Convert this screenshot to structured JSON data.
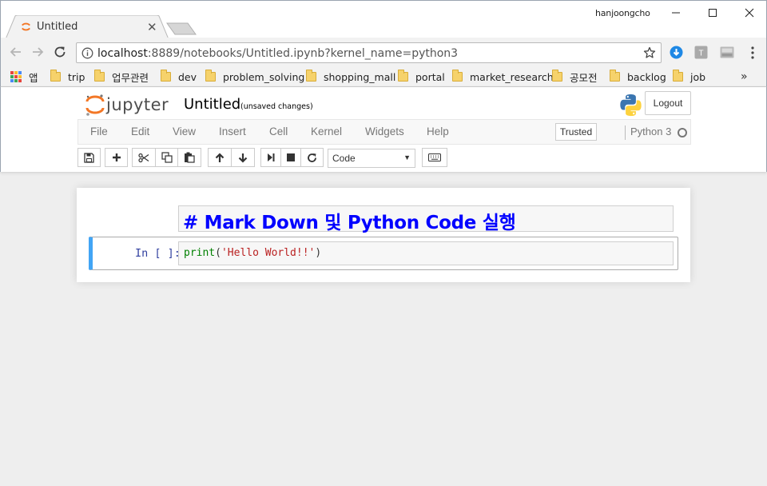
{
  "browser": {
    "tab_title": "Untitled",
    "profile_name": "hanjoongcho",
    "url_host": "localhost",
    "url_rest": ":8889/notebooks/Untitled.ipynb?kernel_name=python3",
    "bookmarks": [
      {
        "label": "앱",
        "icon": "apps-grid-icon"
      },
      {
        "label": "trip",
        "icon": "folder-icon"
      },
      {
        "label": "업무관련",
        "icon": "folder-icon"
      },
      {
        "label": "dev",
        "icon": "folder-icon"
      },
      {
        "label": "problem_solving",
        "icon": "folder-icon"
      },
      {
        "label": "shopping_mall",
        "icon": "folder-icon"
      },
      {
        "label": "portal",
        "icon": "folder-icon"
      },
      {
        "label": "market_research",
        "icon": "folder-icon"
      },
      {
        "label": "공모전",
        "icon": "folder-icon"
      },
      {
        "label": "backlog",
        "icon": "folder-icon"
      },
      {
        "label": "job",
        "icon": "folder-icon"
      }
    ],
    "bookmarks_overflow": "»"
  },
  "jupyter": {
    "notebook_title": "Untitled",
    "save_status": "(unsaved changes)",
    "logout_label": "Logout",
    "menu": [
      "File",
      "Edit",
      "View",
      "Insert",
      "Cell",
      "Kernel",
      "Widgets",
      "Help"
    ],
    "trusted_label": "Trusted",
    "kernel_name": "Python 3",
    "cell_type_selected": "Code"
  },
  "cells": {
    "markdown_text": "# Mark Down 및 Python Code 실행",
    "code_prompt": "In [ ]:",
    "code_func": "print",
    "code_open": "(",
    "code_string": "'Hello World!!'",
    "code_close": ")"
  },
  "colors": {
    "markdown_heading": "#0000ff",
    "code_cell_left_border": "#42a5f5",
    "prompt": "#303f9f",
    "jupyter_orange": "#f37726"
  }
}
